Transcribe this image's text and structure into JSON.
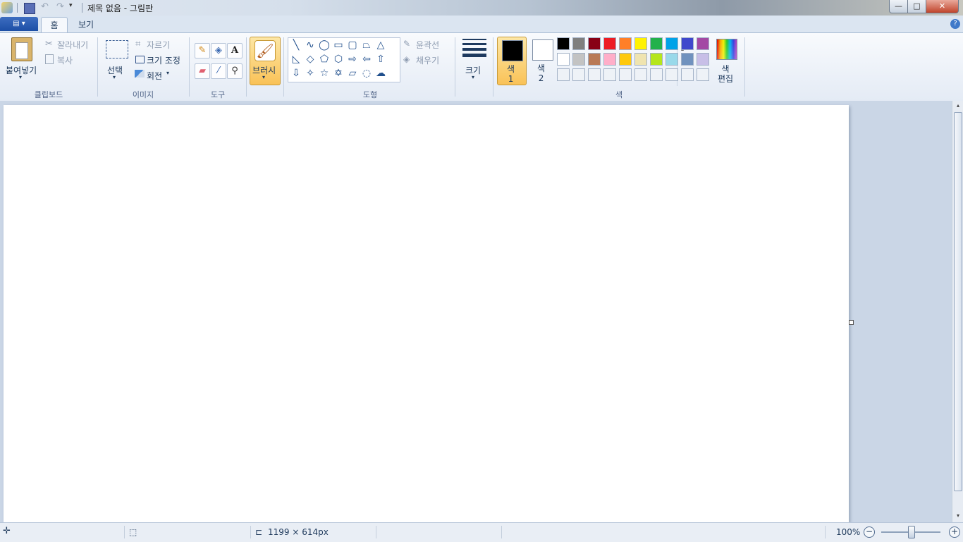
{
  "window": {
    "title": "제목 없음 - 그림판",
    "minimize_glyph": "—",
    "maximize_glyph": "□",
    "close_glyph": "✕"
  },
  "quick_access": {
    "undo_glyph": "↶",
    "redo_glyph": "↷",
    "dropdown_glyph": "▾"
  },
  "tabs": {
    "file_label": "▤ ▾",
    "home": "홈",
    "view": "보기",
    "help": "?"
  },
  "clipboard": {
    "group_label": "클립보드",
    "paste": "붙여넣기",
    "cut": "잘라내기",
    "copy": "복사",
    "cut_glyph": "✂"
  },
  "image": {
    "group_label": "이미지",
    "select": "선택",
    "crop": "자르기",
    "resize": "크기 조정",
    "rotate": "회전",
    "crop_glyph": "⌗",
    "dropdown_glyph": "▾"
  },
  "tools": {
    "group_label": "도구",
    "pencil_glyph": "✎",
    "fill_glyph": "◈",
    "text_glyph": "A",
    "eraser_glyph": "▰",
    "picker_glyph": "⁄",
    "magnifier_glyph": "⚲"
  },
  "brushes": {
    "label": "브러시",
    "glyph": "🖌",
    "dropdown_glyph": "▾"
  },
  "shapes": {
    "group_label": "도형",
    "outline": "윤곽선",
    "fill": "채우기",
    "glyphs": [
      "╲",
      "∿",
      "◯",
      "▭",
      "▢",
      "⏢",
      "△",
      "◺",
      "◇",
      "⬠",
      "⬡",
      "⇨",
      "⇦",
      "⇧",
      "⇩",
      "✧",
      "☆",
      "✡",
      "▱",
      "◌",
      "☁"
    ],
    "scroll_glyphs": [
      "▴",
      "▾",
      "▾"
    ]
  },
  "size": {
    "label": "크기",
    "dropdown_glyph": "▾"
  },
  "colors": {
    "group_label": "색",
    "color1_label": "색\n1",
    "color2_label": "색\n2",
    "color1_value": "#000000",
    "color2_value": "#ffffff",
    "edit_label": "색\n편집",
    "palette_row1": [
      "#000000",
      "#7f7f7f",
      "#880015",
      "#ed1c24",
      "#ff7f27",
      "#fff200",
      "#22b14c",
      "#00a2e8",
      "#3f48cc",
      "#a349a4"
    ],
    "palette_row2": [
      "#ffffff",
      "#c3c3c3",
      "#b97a57",
      "#ffaec9",
      "#ffc90e",
      "#efe4b0",
      "#b5e61d",
      "#99d9ea",
      "#7092be",
      "#c8bfe7"
    ],
    "palette_row3": [
      "#eef2f7",
      "#eef2f7",
      "#eef2f7",
      "#eef2f7",
      "#eef2f7",
      "#eef2f7",
      "#eef2f7",
      "#eef2f7",
      "#eef2f7",
      "#eef2f7"
    ]
  },
  "statusbar": {
    "position_glyph": "✛",
    "selection_glyph": "⬚",
    "size_glyph": "⊏",
    "canvas_size": "1199 × 614px",
    "zoom": "100%",
    "zoom_out": "−",
    "zoom_in": "+"
  },
  "scrollbar": {
    "up_glyph": "▴",
    "down_glyph": "▾"
  }
}
